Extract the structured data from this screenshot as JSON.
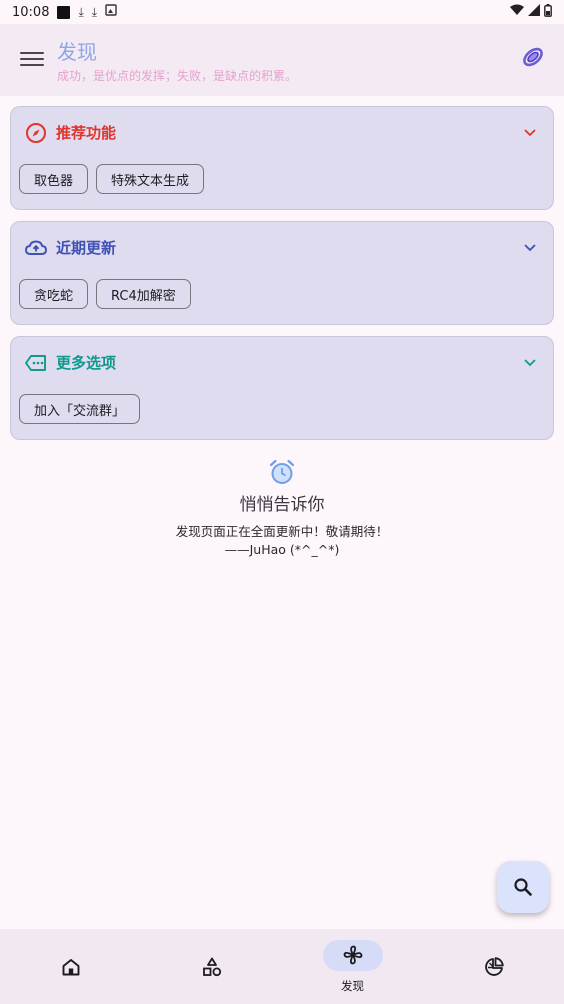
{
  "status_bar": {
    "time": "10:08",
    "icons": [
      "notification-square-icon",
      "download-icon",
      "download-icon",
      "image-notification-icon",
      "wifi-icon",
      "signal-icon",
      "battery-icon"
    ]
  },
  "app_bar": {
    "title": "发现",
    "subtitle": "成功，是优点的发挥；失败，是缺点的积累。",
    "icons": [
      "menu-icon",
      "theme-icon"
    ]
  },
  "cards": [
    {
      "title": "推荐功能",
      "icon": "compass-icon",
      "color": "#e0352b",
      "chips": [
        "取色器",
        "特殊文本生成"
      ]
    },
    {
      "title": "近期更新",
      "icon": "cloud-upload-icon",
      "color": "#3f51b5",
      "chips": [
        "贪吃蛇",
        "RC4加解密"
      ]
    },
    {
      "title": "更多选项",
      "icon": "more-tag-icon",
      "color": "#0e9a8c",
      "chips": [
        "加入「交流群」"
      ]
    }
  ],
  "notice": {
    "title": "悄悄告诉你",
    "line1": "发现页面正在全面更新中！敬请期待！",
    "line2": "——JuHao (*^_^*)",
    "icon": "alarm-clock-icon"
  },
  "fab": {
    "icon": "search-icon"
  },
  "bottom_nav": {
    "items": [
      {
        "icon": "home-icon",
        "label": ""
      },
      {
        "icon": "shapes-icon",
        "label": ""
      },
      {
        "icon": "fan-icon",
        "label": "发现",
        "active": true
      },
      {
        "icon": "pie-chart-icon",
        "label": ""
      }
    ]
  },
  "colors": {
    "background": "#fdf6fb",
    "app_bar": "#f4eaf4",
    "card": "#dfdcf0",
    "accent": "#3f51b5",
    "nav_pill": "#d6dcf7"
  }
}
